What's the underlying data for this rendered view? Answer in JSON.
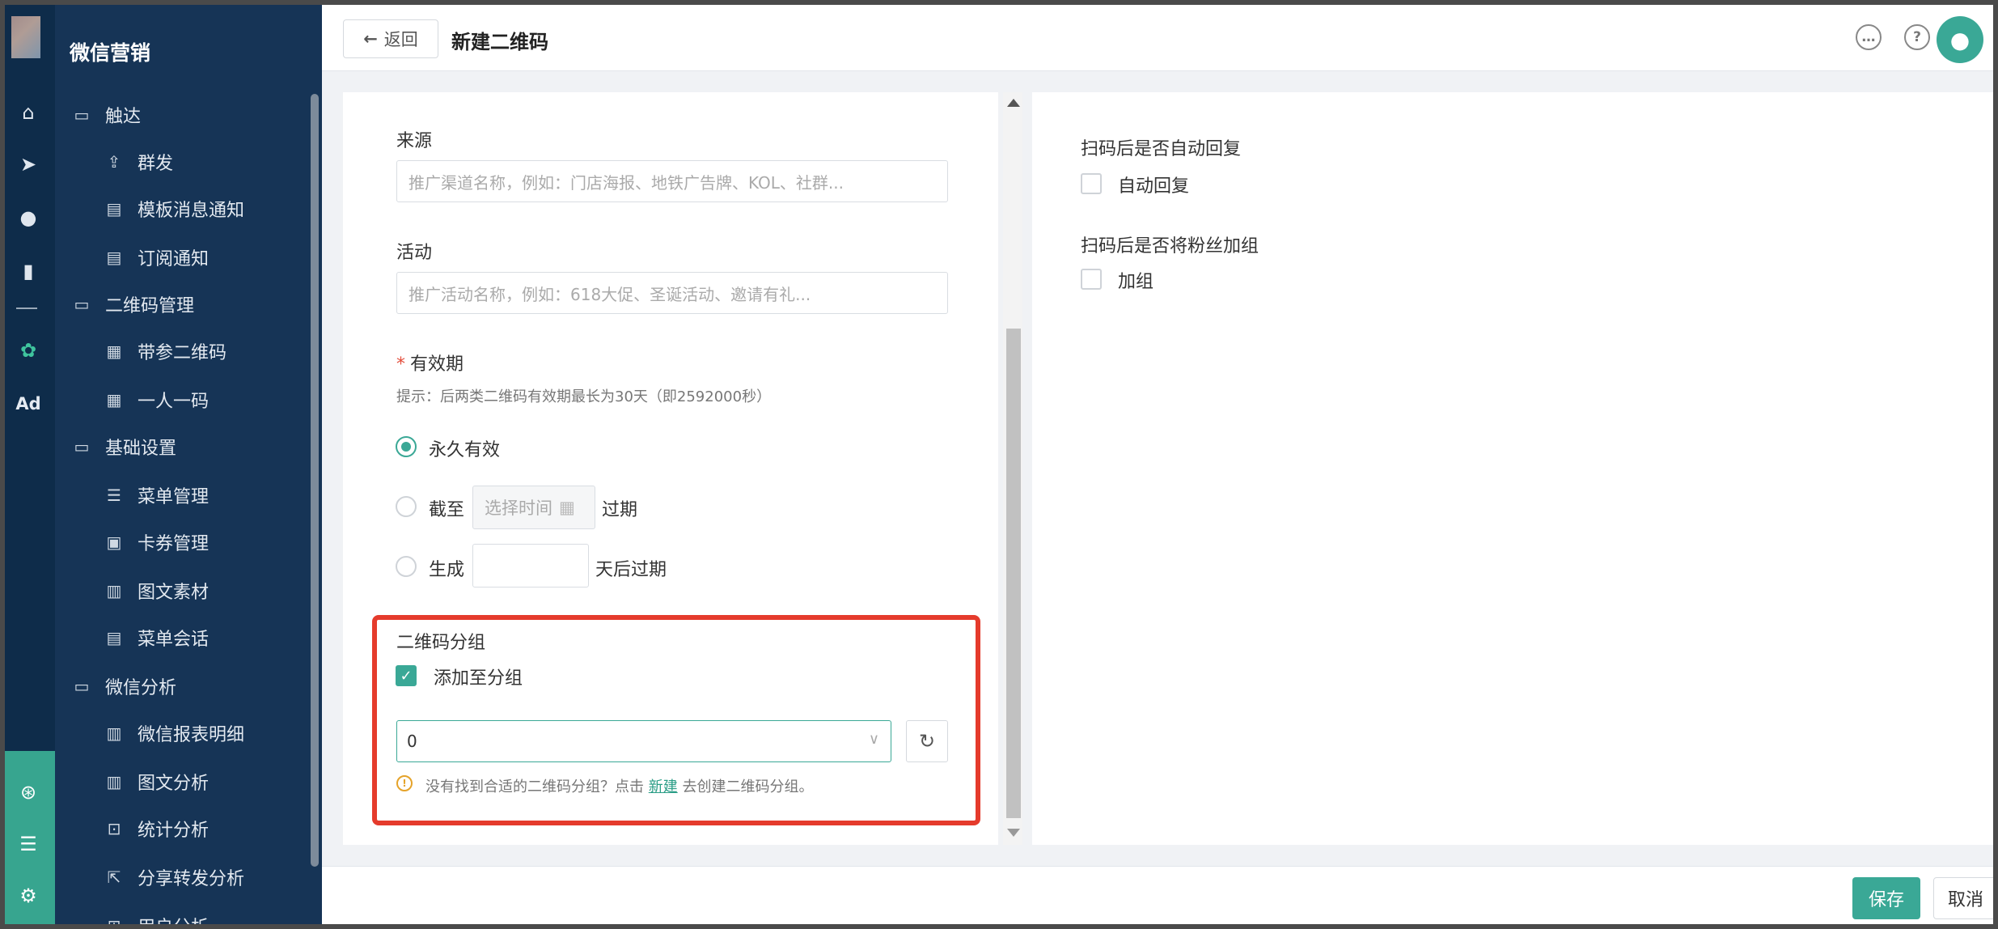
{
  "app": {
    "title": "微信营销"
  },
  "rail": {
    "ad_label": "Ad"
  },
  "sidebar": {
    "items": [
      {
        "label": "触达",
        "icon": "folder-icon"
      },
      {
        "label": "群发",
        "icon": "broadcast-icon"
      },
      {
        "label": "模板消息通知",
        "icon": "template-icon"
      },
      {
        "label": "订阅通知",
        "icon": "subscribe-icon"
      },
      {
        "label": "二维码管理",
        "icon": "folder-icon"
      },
      {
        "label": "带参二维码",
        "icon": "qrcode-icon"
      },
      {
        "label": "一人一码",
        "icon": "qrcode-icon"
      },
      {
        "label": "基础设置",
        "icon": "folder-icon"
      },
      {
        "label": "菜单管理",
        "icon": "menu-list-icon"
      },
      {
        "label": "卡券管理",
        "icon": "card-icon"
      },
      {
        "label": "图文素材",
        "icon": "article-icon"
      },
      {
        "label": "菜单会话",
        "icon": "chat-icon"
      },
      {
        "label": "微信分析",
        "icon": "folder-icon"
      },
      {
        "label": "微信报表明细",
        "icon": "report-icon"
      },
      {
        "label": "图文分析",
        "icon": "report-icon"
      },
      {
        "label": "统计分析",
        "icon": "stats-icon"
      },
      {
        "label": "分享转发分析",
        "icon": "share-icon"
      },
      {
        "label": "用户分析",
        "icon": "user-analysis-icon"
      }
    ]
  },
  "header": {
    "back_label": "返回",
    "page_title": "新建二维码"
  },
  "form": {
    "source_label": "来源",
    "source_placeholder": "推广渠道名称，例如：门店海报、地铁广告牌、KOL、社群...",
    "activity_label": "活动",
    "activity_placeholder": "推广活动名称，例如：618大促、圣诞活动、邀请有礼...",
    "validity_label": "有效期",
    "validity_hint": "提示：后两类二维码有效期最长为30天（即2592000秒）",
    "validity_options": {
      "forever": "永久有效",
      "until_prefix": "截至",
      "until_placeholder": "选择时间",
      "until_suffix": "过期",
      "after_prefix": "生成",
      "after_suffix": "天后过期"
    },
    "group_label": "二维码分组",
    "group_checkbox_label": "添加至分组",
    "group_value": "0",
    "group_tip_prefix": "没有找到合适的二维码分组？点击",
    "group_tip_link": "新建",
    "group_tip_suffix": "去创建二维码分组。"
  },
  "right": {
    "auto_reply_label": "扫码后是否自动回复",
    "auto_reply_option": "自动回复",
    "add_group_label": "扫码后是否将粉丝加组",
    "add_group_option": "加组"
  },
  "footer": {
    "save_label": "保存",
    "cancel_label": "取消"
  },
  "colors": {
    "accent": "#3aa896",
    "sidebar": "#163456",
    "rail": "#0e2c4a",
    "highlight": "#e53b2c"
  }
}
